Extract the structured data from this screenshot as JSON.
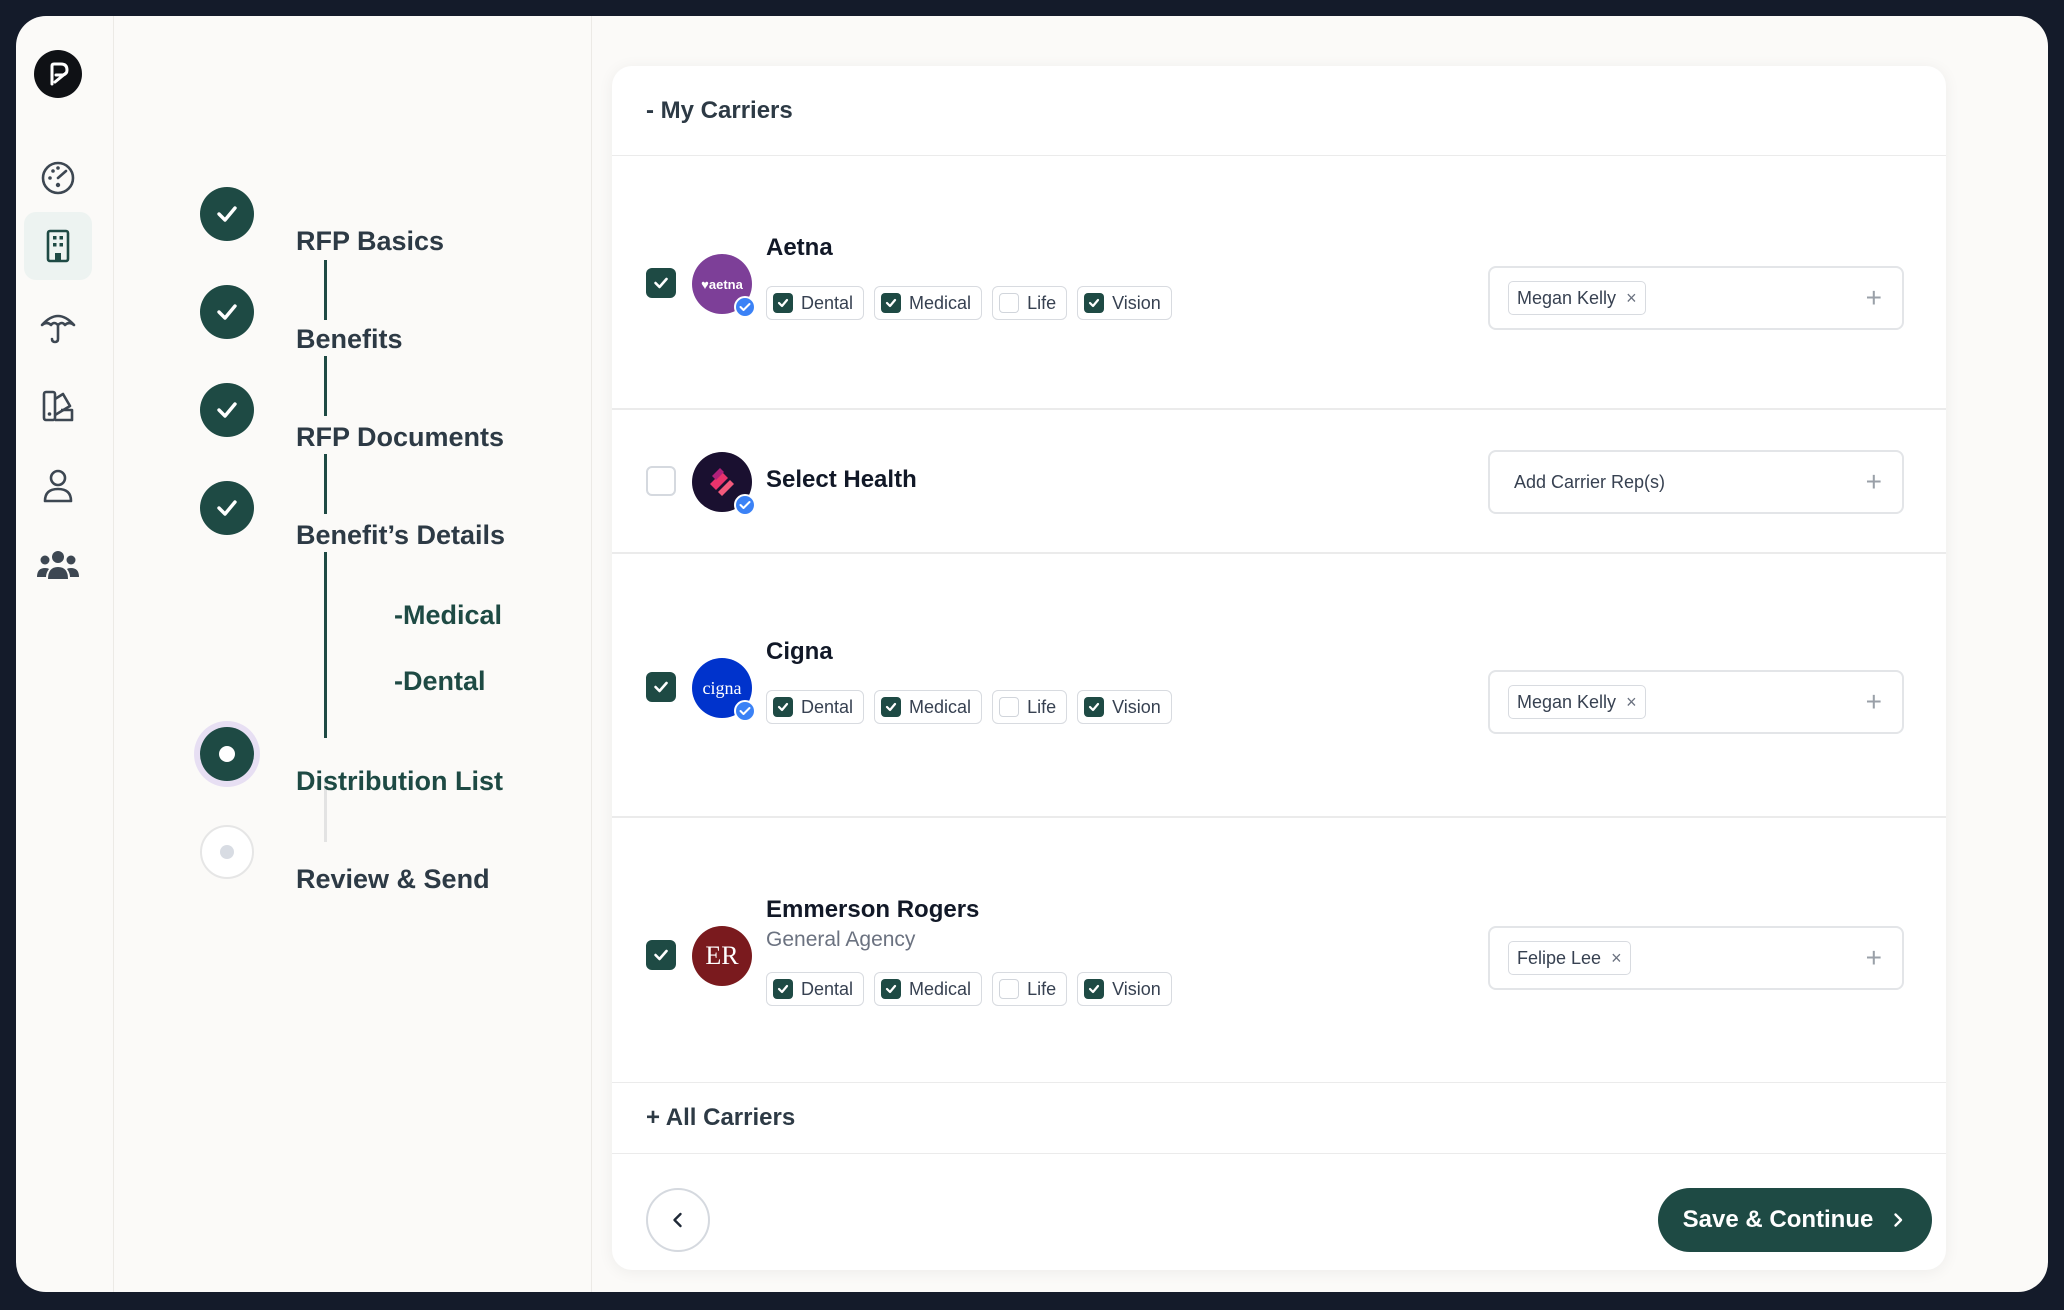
{
  "sidebar": {
    "icons": [
      "logo-icon",
      "dashboard-icon",
      "building-icon",
      "umbrella-icon",
      "palette-icon",
      "user-icon",
      "team-icon"
    ],
    "active_index": 2
  },
  "stepper": {
    "steps": [
      {
        "label": "RFP Basics",
        "state": "done"
      },
      {
        "label": "Benefits",
        "state": "done"
      },
      {
        "label": "RFP Documents",
        "state": "done"
      },
      {
        "label": "Benefit’s Details",
        "state": "done"
      },
      {
        "label": "Distribution List",
        "state": "current"
      },
      {
        "label": "Review & Send",
        "state": "pending"
      }
    ],
    "substeps": [
      "-Medical",
      "-Dental"
    ]
  },
  "my_carriers": {
    "header": "- My Carriers",
    "carriers": [
      {
        "name": "Aetna",
        "subtitle": "",
        "selected": true,
        "logo_text": "♥aetna",
        "logo_color": "#7d3f98",
        "lines": [
          {
            "label": "Dental",
            "checked": true
          },
          {
            "label": "Medical",
            "checked": true
          },
          {
            "label": "Life",
            "checked": false
          },
          {
            "label": "Vision",
            "checked": true
          }
        ],
        "reps": [
          "Megan Kelly"
        ],
        "rep_placeholder": ""
      },
      {
        "name": "Select Health",
        "subtitle": "",
        "selected": false,
        "logo_text": "",
        "logo_color": "#1a1030",
        "lines": [],
        "reps": [],
        "rep_placeholder": "Add Carrier Rep(s)"
      },
      {
        "name": "Cigna",
        "subtitle": "",
        "selected": true,
        "logo_text": "cigna",
        "logo_color": "#0033cc",
        "lines": [
          {
            "label": "Dental",
            "checked": true
          },
          {
            "label": "Medical",
            "checked": true
          },
          {
            "label": "Life",
            "checked": false
          },
          {
            "label": "Vision",
            "checked": true
          }
        ],
        "reps": [
          "Megan Kelly"
        ],
        "rep_placeholder": ""
      },
      {
        "name": "Emmerson Rogers",
        "subtitle": "General Agency",
        "selected": true,
        "logo_text": "ER",
        "logo_color": "#7a1a1e",
        "lines": [
          {
            "label": "Dental",
            "checked": true
          },
          {
            "label": "Medical",
            "checked": true
          },
          {
            "label": "Life",
            "checked": false
          },
          {
            "label": "Vision",
            "checked": true
          }
        ],
        "reps": [
          "Felipe Lee"
        ],
        "rep_placeholder": ""
      }
    ]
  },
  "all_carriers": {
    "header": "+ All Carriers"
  },
  "footer": {
    "save_label": "Save & Continue"
  },
  "colors": {
    "primary": "#1e4a44",
    "current_ring": "#e7dff3",
    "verified": "#3b82f6"
  }
}
